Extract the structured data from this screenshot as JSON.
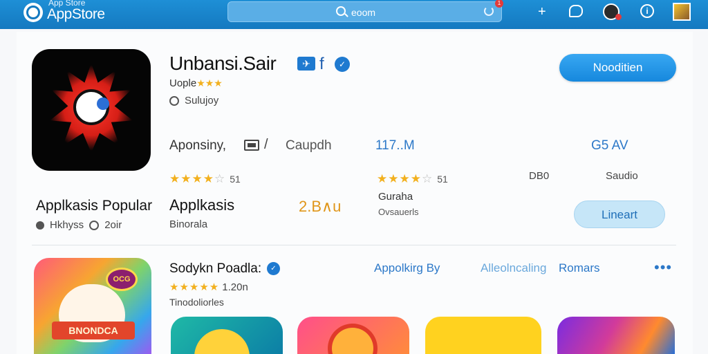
{
  "header": {
    "logo_top": "App Store",
    "logo_main": "AppStore",
    "search_text": "eoom",
    "search_badge": "1"
  },
  "featured": {
    "title": "Unbansi.Sair",
    "title_badge_letter": "f",
    "developer": "Uople",
    "developer_stars": "★★★",
    "category": "Sulujoy",
    "primary_button": "Nooditien",
    "meta": {
      "m1": "Aponsiny,",
      "m2": "Caupdh",
      "m3": "117..M",
      "m4": "G5 AV"
    },
    "rating_left": {
      "stars_on": "★★★★",
      "stars_off": "☆",
      "count": "51"
    },
    "rating_mid": {
      "stars_on": "★★★★",
      "stars_off": "☆",
      "count": "51"
    },
    "stat_label": "DB0",
    "stat_label_2": "Saudio",
    "sub_title": "Applkasis Popular",
    "sub_meta_1": "Hkhyss",
    "sub_meta_2": "2oir",
    "second_title": "Applkasis",
    "second_sub": "Binorala",
    "age_badge": "2.B∧u",
    "gurh": "Gurahа",
    "gurh_sub": "Ovsauerls",
    "secondary_button": "Lineart"
  },
  "section2": {
    "icon_tag": "OCG",
    "icon_ribbon": "BNONDCA",
    "title": "Sodykn Poadla:",
    "stars": "★★★★★",
    "rating_count": "1.20n",
    "subtitle": "Tinodoliorles",
    "tabs": [
      "Appolkirg By",
      "Alleolncaling",
      "Romars"
    ],
    "more": "•••"
  },
  "colors": {
    "topbar": "#1479c0",
    "accent": "#1688dd",
    "star": "#f2b01e",
    "link": "#2c78c8"
  }
}
